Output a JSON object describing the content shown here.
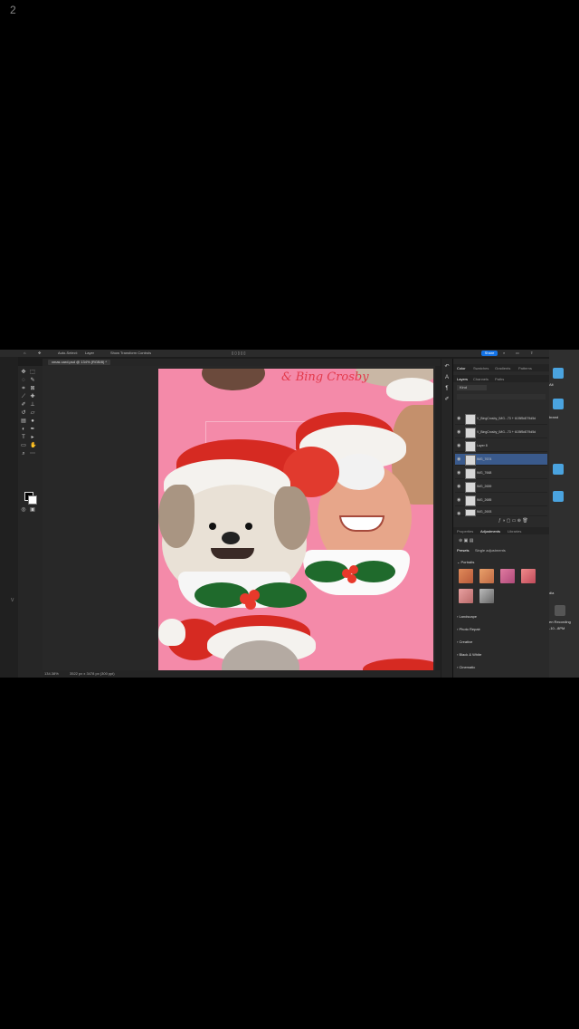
{
  "side_number": "2",
  "side_letter": "V",
  "menubar": {
    "items": [
      "Auto-Select:",
      "Layer",
      "Show Transform Controls"
    ],
    "share_label": "Share"
  },
  "document_tab": "xmas card.psd @ 134% (RGB/8) *",
  "canvas_title_text": "& Bing Crosby",
  "status": {
    "zoom": "134.38%",
    "doc_info": "3522 px x 3478 px (300 ppi)"
  },
  "panels": {
    "color_tabs": [
      "Color",
      "Swatches",
      "Gradients",
      "Patterns"
    ],
    "layer_tabs": [
      "Layers",
      "Channels",
      "Paths"
    ],
    "kind_label": "Kind",
    "layers": [
      {
        "name": "V_BingCrosby_IMG...73 + t105f5d079d5d"
      },
      {
        "name": "V_BingCrosby_IMG...73 + t105f5d079d5d"
      },
      {
        "name": "Layer 8"
      },
      {
        "name": "IMG_7674",
        "selected": true
      },
      {
        "name": "IMG_7668"
      },
      {
        "name": "IMG_2659"
      },
      {
        "name": "IMG_2685"
      },
      {
        "name": "IMG_2693"
      }
    ],
    "prop_tabs": [
      "Properties",
      "Adjustments",
      "Libraries"
    ],
    "adj_subtabs": [
      "Presets",
      "Single adjustments"
    ],
    "adj_sections": [
      "Portraits",
      "Landscape",
      "Photo Repair",
      "Creative",
      "Black & White",
      "Cinematic"
    ]
  },
  "dock": {
    "label1": "Alt",
    "label2": "brand",
    "label3": "dia",
    "label4": "en Recording",
    "label5": "-10...8PM"
  },
  "colors": {
    "canvas_pink": "#f48aa9",
    "selected_layer": "#3a5a8c",
    "accent_blue": "#1473e6"
  }
}
